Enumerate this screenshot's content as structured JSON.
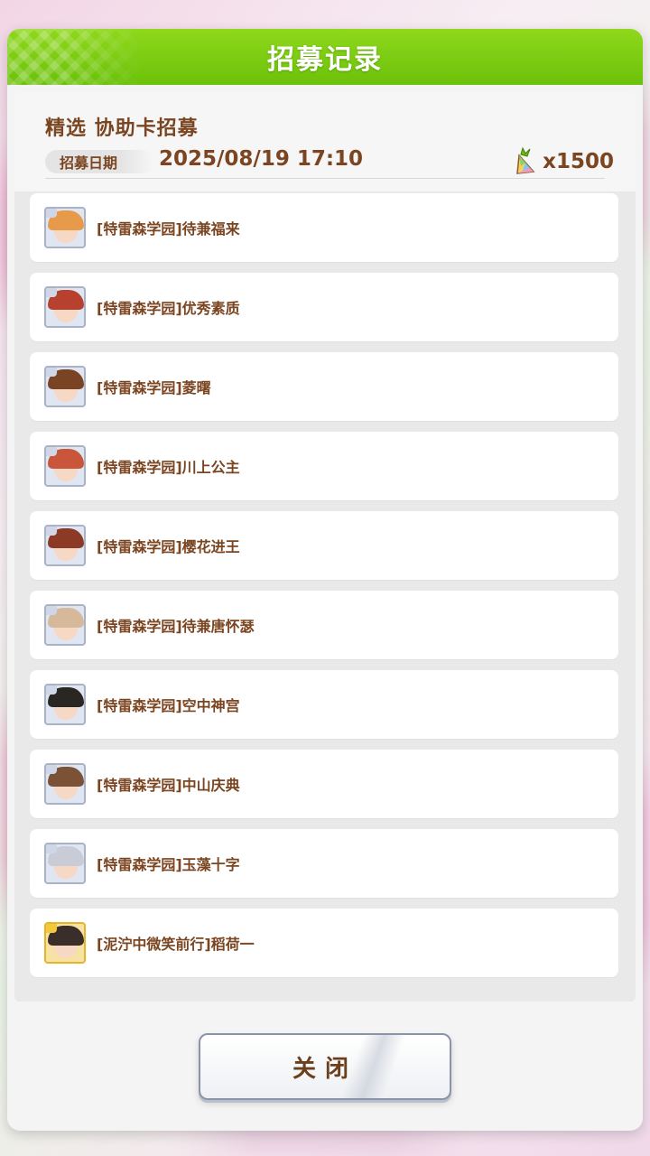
{
  "dialog": {
    "title": "招募记录",
    "banner_name": "精选 协助卡招募",
    "date_label": "招募日期",
    "date_value": "2025/08/19 17:10",
    "cost_amount": "x1500",
    "cost_icon": "carrot-icon",
    "close_label": "关闭"
  },
  "results": [
    {
      "label": "[特雷森学园]待兼福来",
      "rarity": "silver",
      "hair": "#e79a4a"
    },
    {
      "label": "[特雷森学园]优秀素质",
      "rarity": "silver",
      "hair": "#b8402e"
    },
    {
      "label": "[特雷森学园]菱曙",
      "rarity": "silver",
      "hair": "#7a4424"
    },
    {
      "label": "[特雷森学园]川上公主",
      "rarity": "silver",
      "hair": "#c9553a"
    },
    {
      "label": "[特雷森学园]樱花进王",
      "rarity": "silver",
      "hair": "#8c3a26"
    },
    {
      "label": "[特雷森学园]待兼唐怀瑟",
      "rarity": "silver",
      "hair": "#d6b89a"
    },
    {
      "label": "[特雷森学园]空中神宫",
      "rarity": "silver",
      "hair": "#2a2622"
    },
    {
      "label": "[特雷森学园]中山庆典",
      "rarity": "silver",
      "hair": "#7b5236"
    },
    {
      "label": "[特雷森学园]玉藻十字",
      "rarity": "silver",
      "hair": "#c9ccd6"
    },
    {
      "label": "[泥泞中微笑前行]稻荷一",
      "rarity": "gold",
      "hair": "#3a2e2a"
    }
  ]
}
